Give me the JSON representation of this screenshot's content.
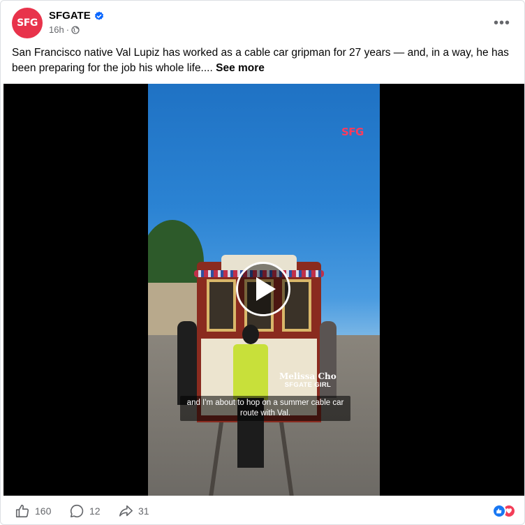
{
  "post": {
    "page_name": "SFGATE",
    "avatar_text": "SFG",
    "time": "16h",
    "separator": "·",
    "more_label": "•••",
    "text": "San Francisco native Val Lupiz has worked as a cable car gripman for 27 years — and, in a way, he has been preparing for the job his whole life....",
    "see_more_label": "See more"
  },
  "video": {
    "watermark": "SFG",
    "name_tag_name": "Melissa Cho",
    "name_tag_role": "SFGATE GIRL",
    "caption": "and I'm about to hop on a summer cable car route with Val."
  },
  "footer": {
    "like_count": "160",
    "comment_count": "12",
    "share_count": "31"
  },
  "colors": {
    "brand": "#e8334b",
    "verified": "#0866ff",
    "like_reaction": "#1877f2",
    "love_reaction": "#f33e58"
  }
}
